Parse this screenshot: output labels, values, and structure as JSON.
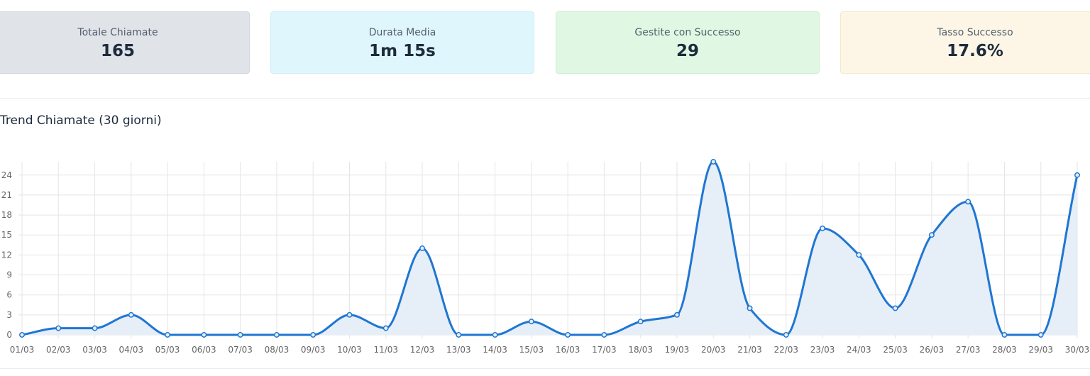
{
  "stats": [
    {
      "label": "Totale Chiamate",
      "value": "165"
    },
    {
      "label": "Durata Media",
      "value": "1m 15s"
    },
    {
      "label": "Gestite con Successo",
      "value": "29"
    },
    {
      "label": "Tasso Successo",
      "value": "17.6%"
    }
  ],
  "chart_data": {
    "type": "area",
    "title": "Trend Chiamate (30 giorni)",
    "categories": [
      "01/03",
      "02/03",
      "03/03",
      "04/03",
      "05/03",
      "06/03",
      "07/03",
      "08/03",
      "09/03",
      "10/03",
      "11/03",
      "12/03",
      "13/03",
      "14/03",
      "15/03",
      "16/03",
      "17/03",
      "18/03",
      "19/03",
      "20/03",
      "21/03",
      "22/03",
      "23/03",
      "24/03",
      "25/03",
      "26/03",
      "27/03",
      "28/03",
      "29/03",
      "30/03"
    ],
    "values": [
      0,
      1,
      1,
      3,
      0,
      0,
      0,
      0,
      0,
      3,
      1,
      13,
      0,
      0,
      2,
      0,
      0,
      2,
      3,
      26,
      4,
      0,
      16,
      12,
      4,
      15,
      20,
      0,
      0,
      24
    ],
    "yticks": [
      0,
      3,
      6,
      9,
      12,
      15,
      18,
      21,
      24
    ],
    "ylim": [
      0,
      26
    ],
    "grid": true,
    "line_color": "#1f76d2",
    "fill_color": "#e6eef8"
  }
}
